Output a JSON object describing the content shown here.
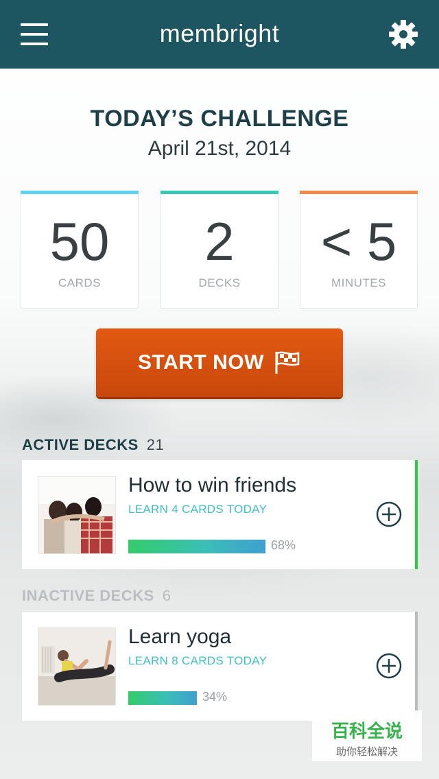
{
  "header": {
    "title": "membright",
    "menu_icon": "hamburger-menu-icon",
    "settings_icon": "gear-icon",
    "background": "#1d5661"
  },
  "challenge": {
    "title": "TODAY’S CHALLENGE",
    "date": "April 21st, 2014"
  },
  "stats": [
    {
      "value": "50",
      "label": "CARDS",
      "accent": "#5fd3ef"
    },
    {
      "value": "2",
      "label": "DECKS",
      "accent": "#37c8b6"
    },
    {
      "value": "< 5",
      "label": "MINUTES",
      "accent": "#f08a4b"
    }
  ],
  "start_button": {
    "label": "START NOW",
    "icon": "checkered-flag-icon",
    "color": "#d55010"
  },
  "active_section": {
    "title": "ACTIVE DECKS",
    "count": "21",
    "color": "#1e3e48"
  },
  "inactive_section": {
    "title": "INACTIVE DECKS",
    "count": "6",
    "color": "#b9bfc1"
  },
  "decks": [
    {
      "name": "How to win friends",
      "subtitle": "LEARN 4 CARDS TODAY",
      "progress": 0.68,
      "progress_label": "68%",
      "image": "friends-hugging-photo",
      "edge_color": "#2ecc40",
      "action_icon": "plus-circle-icon"
    },
    {
      "name": "Learn yoga",
      "subtitle": "LEARN 8 CARDS TODAY",
      "progress": 0.34,
      "progress_label": "34%",
      "image": "yoga-pose-photo",
      "edge_color": "#b8bcbd",
      "action_icon": "plus-circle-icon"
    }
  ],
  "watermark": {
    "main": "百科全说",
    "sub": "助你轻松解决"
  }
}
